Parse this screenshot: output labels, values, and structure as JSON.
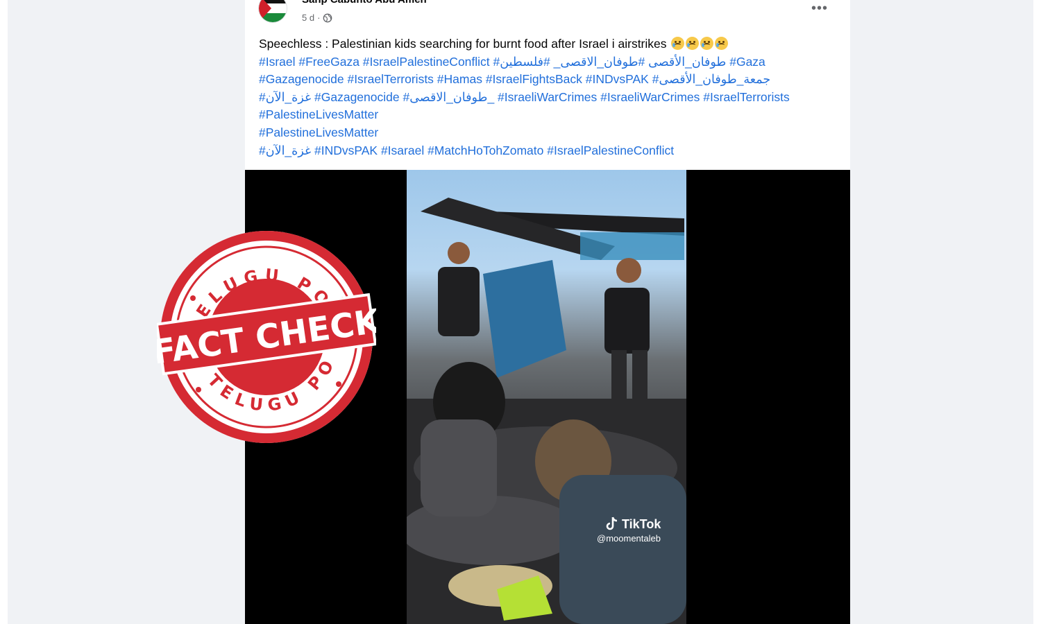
{
  "post": {
    "author": "Sanp Cabunto Abu Amen",
    "time": "5 d",
    "audience_icon": "globe-icon",
    "more_icon": "more-options-icon",
    "caption": {
      "text": "Speechless : Palestinian kids searching for burnt food after Israel i airstrikes",
      "emoji_count": 4,
      "hashtag_lines": [
        "#Israel #FreeGaza #IsraelPalestineConflict #طوفان_الأقصى #طوفان_الاقصى_ #فلسطين #Gaza",
        "#Gazagenocide #IsraelTerrorists #Hamas #IsraelFightsBack #INDvsPAK #جمعة_طوفان_الأقصى",
        "#غزة_الآن #Gazagenocide #طوفان_الاقصى_ #IsraeliWarCrimes #IsraeliWarCrimes #IsraelTerrorists",
        "#PalestineLivesMatter",
        "#PalestineLivesMatter",
        "#غزة_الآن #INDvsPAK #Isarael #MatchHoTohZomato #IsraelPalestineConflict"
      ]
    },
    "video": {
      "watermark_brand": "TikTok",
      "watermark_user": "@moomentaleb"
    }
  },
  "stamp": {
    "top_text": "TELUGU POST",
    "center_text": "FACT CHECK",
    "bottom_text": "TELUGU POST",
    "color": "#d52a33"
  }
}
